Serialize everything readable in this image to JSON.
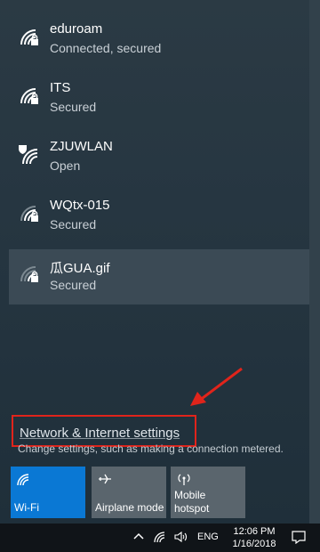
{
  "networks": [
    {
      "name": "eduroam",
      "status": "Connected, secured",
      "icon": "wifi-secured-icon"
    },
    {
      "name": "ITS",
      "status": "Secured",
      "icon": "wifi-secured-icon"
    },
    {
      "name": "ZJUWLAN",
      "status": "Open",
      "icon": "wifi-open-shield-icon"
    },
    {
      "name": "WQtx-015",
      "status": "Secured",
      "icon": "wifi-secured-icon"
    },
    {
      "name": "瓜GUA.gif",
      "status": "Secured",
      "icon": "wifi-secured-icon"
    }
  ],
  "settings": {
    "link": "Network & Internet settings",
    "description": "Change settings, such as making a connection metered."
  },
  "tiles": {
    "wifi": "Wi-Fi",
    "airplane": "Airplane mode",
    "hotspot_line1": "Mobile",
    "hotspot_line2": "hotspot"
  },
  "taskbar": {
    "language": "ENG",
    "time": "12:06 PM",
    "date": "1/16/2018"
  },
  "colors": {
    "accent": "#0a78d4",
    "highlight": "#e0241b"
  }
}
